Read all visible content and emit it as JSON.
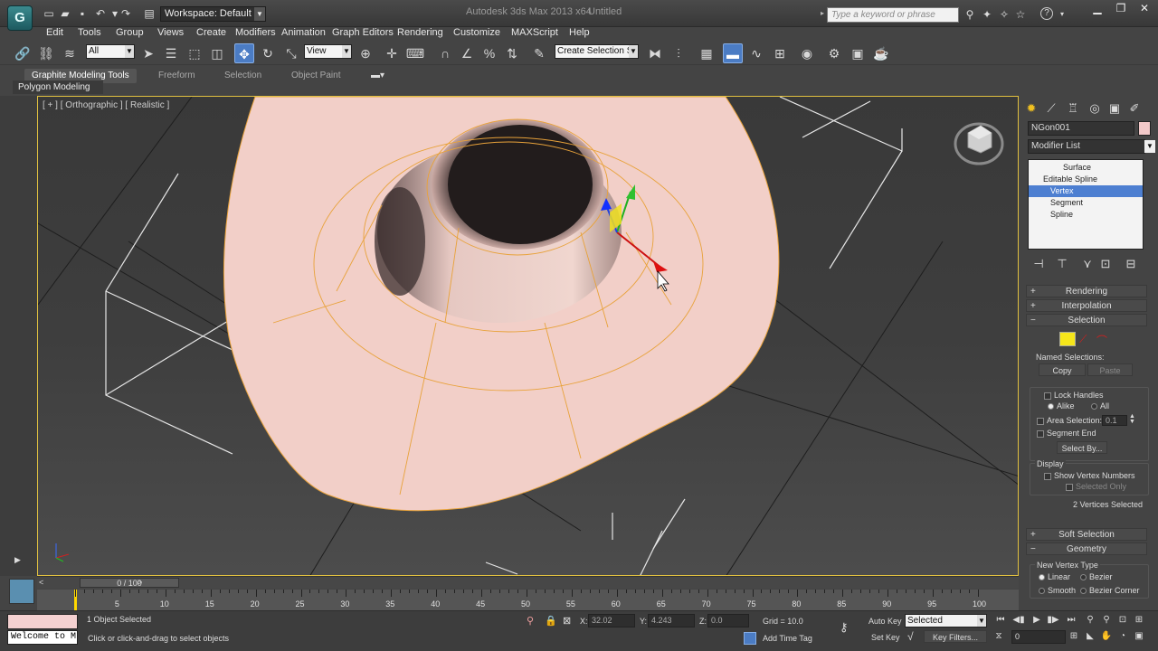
{
  "titlebar": {
    "app_icon": "3ds-max-logo",
    "app_letter": "G",
    "workspace": "Workspace: Default",
    "title": "Autodesk 3ds Max  2013 x64",
    "document": "Untitled",
    "search_placeholder": "Type a keyword or phrase"
  },
  "menu": [
    "Edit",
    "Tools",
    "Group",
    "Views",
    "Create",
    "Modifiers",
    "Animation",
    "Graph Editors",
    "Rendering",
    "Customize",
    "MAXScript",
    "Help"
  ],
  "toolbar": {
    "filter": "All",
    "ref_coord": "View",
    "named_selection": "Create Selection Se"
  },
  "ribbon": {
    "tabs": [
      "Graphite Modeling Tools",
      "Freeform",
      "Selection",
      "Object Paint"
    ],
    "panel": "Polygon Modeling"
  },
  "viewport": {
    "label": "[ + ] [ Orthographic ] [ Realistic ]",
    "object_color": "#f2cfc8",
    "spline_color": "#e8a23a"
  },
  "command_panel": {
    "object_name": "NGon001",
    "modifier_list": "Modifier List",
    "stack": [
      "Surface",
      "Editable Spline",
      "Vertex",
      "Segment",
      "Spline"
    ],
    "rollouts": {
      "rendering": "Rendering",
      "interpolation": "Interpolation",
      "selection": "Selection",
      "soft_selection": "Soft Selection",
      "geometry": "Geometry"
    },
    "named_selections": "Named Selections:",
    "copy": "Copy",
    "paste": "Paste",
    "lock_handles": "Lock Handles",
    "alike": "Alike",
    "all": "All",
    "area_selection": "Area Selection:",
    "area_value": "0.1",
    "segment_end": "Segment End",
    "select_by": "Select By...",
    "display": "Display",
    "show_vertex_numbers": "Show Vertex Numbers",
    "selected_only": "Selected Only",
    "vertices_selected": "2 Vertices Selected",
    "new_vertex_type": "New Vertex Type",
    "linear": "Linear",
    "bezier": "Bezier",
    "smooth": "Smooth",
    "bezier_corner": "Bezier Corner"
  },
  "timeline": {
    "frame_label": "0 / 100",
    "ticks": [
      "5",
      "10",
      "15",
      "20",
      "25",
      "30",
      "35",
      "40",
      "45",
      "50",
      "55",
      "60",
      "65",
      "70",
      "75",
      "80",
      "85",
      "90",
      "95",
      "100"
    ]
  },
  "status": {
    "maxscript_out": "Welcome to M",
    "selection_status": "1 Object Selected",
    "prompt": "Click or click-and-drag to select objects",
    "x_label": "X:",
    "x_value": "32.02",
    "y_label": "Y:",
    "y_value": "4.243",
    "z_label": "Z:",
    "z_value": "0.0",
    "grid": "Grid = 10.0",
    "add_time_tag": "Add Time Tag",
    "auto_key": "Auto Key",
    "set_key": "Set Key",
    "selected": "Selected",
    "key_filters": "Key Filters...",
    "frame": "0"
  }
}
